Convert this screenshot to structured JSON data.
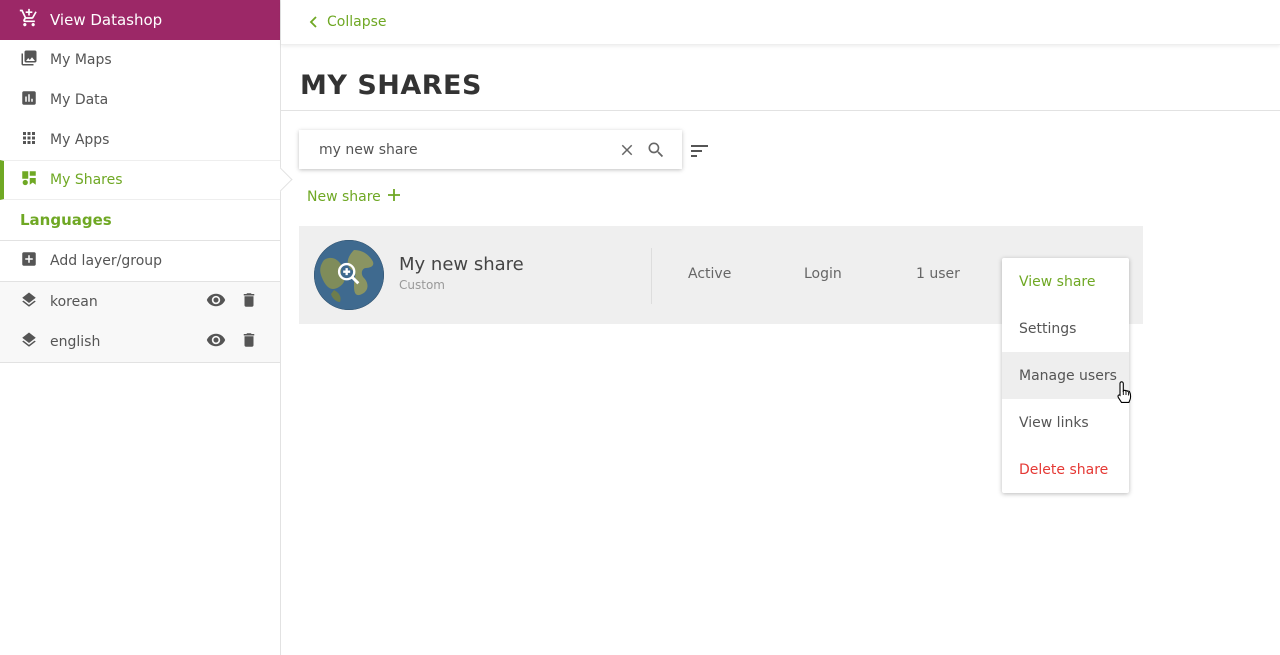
{
  "sidebar": {
    "top_item": {
      "label": "View Datashop",
      "icon": "cart-plus-icon"
    },
    "nav": [
      {
        "label": "My Maps",
        "icon": "maps-icon"
      },
      {
        "label": "My Data",
        "icon": "chart-icon"
      },
      {
        "label": "My Apps",
        "icon": "apps-grid-icon"
      },
      {
        "label": "My Shares",
        "icon": "shares-icon",
        "active": true
      }
    ],
    "section_title": "Languages",
    "add_layer_label": "Add layer/group",
    "layers": [
      {
        "label": "korean",
        "icon": "layers-icon"
      },
      {
        "label": "english",
        "icon": "layers-icon"
      }
    ]
  },
  "header": {
    "collapse_label": "Collapse"
  },
  "page": {
    "title": "MY SHARES"
  },
  "search": {
    "value": "my new share"
  },
  "new_share_label": "New share",
  "share": {
    "name": "My new share",
    "type": "Custom",
    "status": "Active",
    "access": "Login",
    "users": "1 user"
  },
  "menu": {
    "items": [
      {
        "label": "View share"
      },
      {
        "label": "Settings"
      },
      {
        "label": "Manage users"
      },
      {
        "label": "View links"
      },
      {
        "label": "Delete share"
      }
    ]
  },
  "colors": {
    "brand": "#9c2867",
    "accent": "#6fa824",
    "danger": "#e53935"
  }
}
